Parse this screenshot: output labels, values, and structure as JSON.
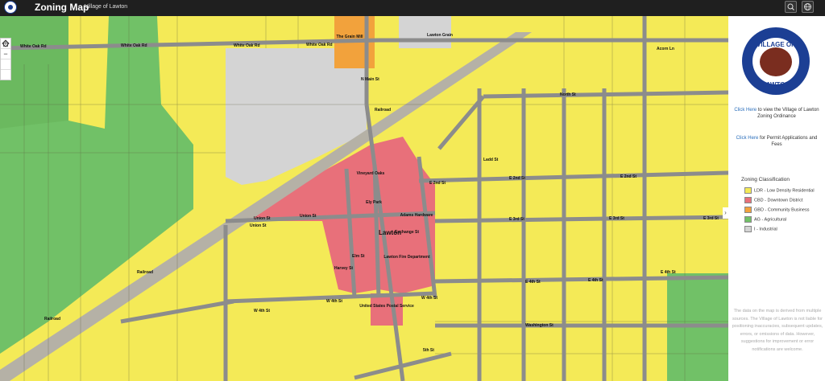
{
  "header": {
    "title": "Zoning Map",
    "subtitle": "Village of Lawton",
    "search_icon": "search-icon",
    "basemap_icon": "globe-icon"
  },
  "map_controls": {
    "zoom_in": "+",
    "zoom_out": "−",
    "home_icon": "home-icon",
    "locate_icon": "locate-icon"
  },
  "map_labels": {
    "town": "Lawton",
    "streets": [
      "White Oak Rd",
      "White Oak Rd",
      "White Oak Rd",
      "White Oak Rd",
      "Union St",
      "Union St",
      "Union St",
      "Exchange St",
      "E 2nd St",
      "E 2nd St",
      "E 2nd St",
      "E 3rd St",
      "E 3rd St",
      "E 3rd St",
      "E 4th St",
      "E 4th St",
      "E 4th St",
      "W 4th St",
      "W 4th St",
      "W 4th St",
      "North St",
      "N Main St",
      "Ladd St",
      "Railroad",
      "Railroad",
      "Railroad",
      "Harvey St",
      "Elm St",
      "Washington St",
      "5th St",
      "Acorn Ln"
    ],
    "places": [
      "The Grain Mill",
      "Lawton Grain",
      "Vineyard Oaks",
      "Ely Park",
      "Adams Hardware",
      "Lawton Fire Department",
      "United States Postal Service"
    ]
  },
  "panel": {
    "seal_top": "VILLAGE OF",
    "seal_bottom": "LAWTON",
    "link1_text": "Click Here",
    "link1_rest": " to view the Village of Lawton Zoning Ordinance",
    "link2_text": "Click Here",
    "link2_rest": " for Permit Applications and Fees",
    "legend_title": "Zoning Classification",
    "legend": [
      {
        "label": "LDR - Low Density Residential",
        "color": "#f4ea57"
      },
      {
        "label": "CBD - Downtown District",
        "color": "#e8707a"
      },
      {
        "label": "GBD - Community Business",
        "color": "#f2a23c"
      },
      {
        "label": "AG - Agricultural",
        "color": "#71c167"
      },
      {
        "label": "I - Industrial",
        "color": "#d4d4d4"
      }
    ],
    "disclaimer": "The data on the map is derived from multiple sources. The Village of Lawton is not liable for positioning inaccuracies, subsequent updates, errors, or omissions of data. However, suggestions for improvement or error notifications are welcome."
  },
  "colors": {
    "residential": "#f4ea57",
    "downtown": "#e8707a",
    "business": "#f2a23c",
    "agricultural": "#71c167",
    "industrial": "#d4d4d4",
    "road": "#8c8c8c",
    "topbar": "#1f1f1f"
  }
}
